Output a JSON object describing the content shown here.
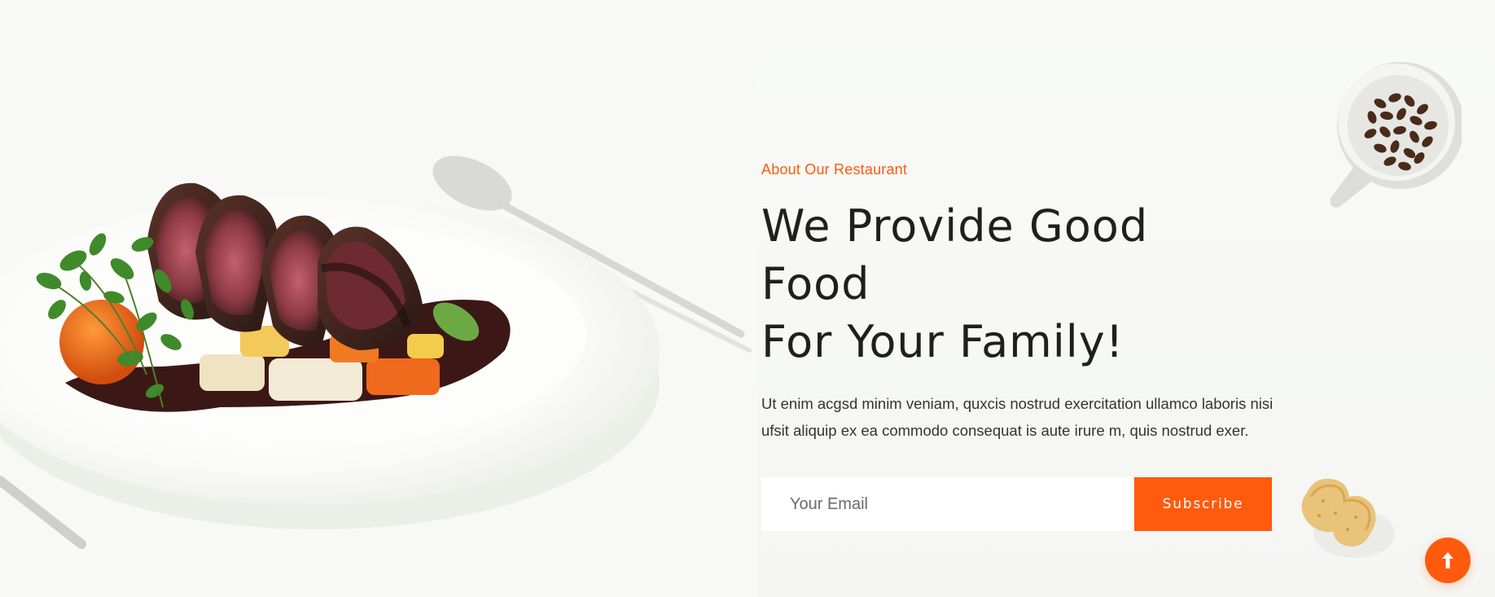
{
  "about": {
    "eyebrow": "About Our Restaurant",
    "headline_line1": "We Provide Good Food",
    "headline_line2": "For Your Family!",
    "description": "Ut enim acgsd minim veniam, quxcis nostrud exercitation ullamco laboris nisi ufsit aliquip ex ea commodo consequat is aute irure m, quis nostrud exer."
  },
  "subscribe": {
    "email_placeholder": "Your Email",
    "email_value": "",
    "button_label": "Subscribe"
  },
  "icons": {
    "back_to_top": "arrow-up-icon"
  },
  "colors": {
    "accent": "#ff5a0d",
    "heading": "#1f1f1f",
    "text": "#333333",
    "background": "#f7f8f6"
  }
}
